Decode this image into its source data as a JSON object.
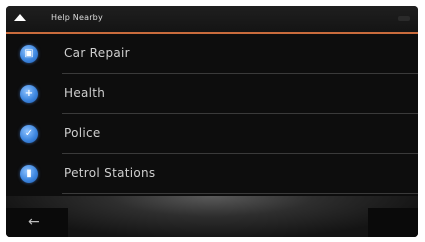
{
  "header": {
    "title": "Help Nearby"
  },
  "items": [
    {
      "label": "Car Repair",
      "icon": "car-repair-icon"
    },
    {
      "label": "Health",
      "icon": "health-cross-icon"
    },
    {
      "label": "Police",
      "icon": "police-icon"
    },
    {
      "label": "Petrol Stations",
      "icon": "fuel-pump-icon"
    }
  ],
  "footer": {
    "back_icon": "back-arrow-icon"
  },
  "colors": {
    "accent": "#c96b3c",
    "icon_blue": "#3e87e0",
    "background": "#0d0d0d"
  }
}
